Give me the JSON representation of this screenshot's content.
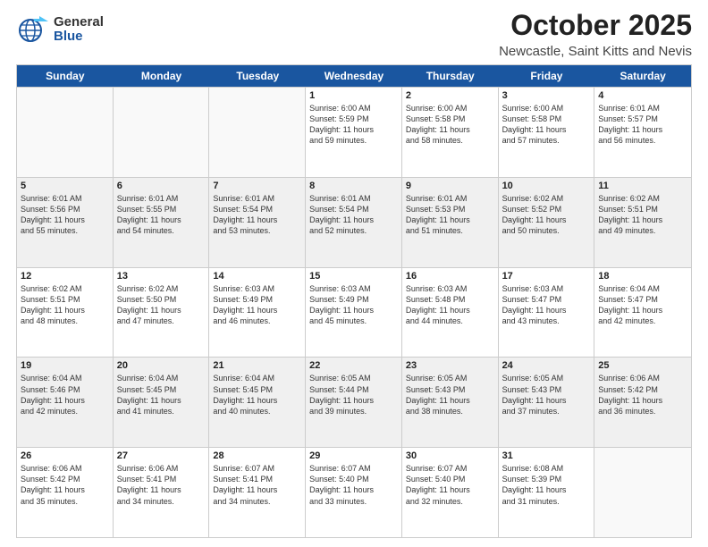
{
  "header": {
    "logo_general": "General",
    "logo_blue": "Blue",
    "month": "October 2025",
    "location": "Newcastle, Saint Kitts and Nevis"
  },
  "weekdays": [
    "Sunday",
    "Monday",
    "Tuesday",
    "Wednesday",
    "Thursday",
    "Friday",
    "Saturday"
  ],
  "weeks": [
    [
      {
        "day": "",
        "info": "",
        "empty": true
      },
      {
        "day": "",
        "info": "",
        "empty": true
      },
      {
        "day": "",
        "info": "",
        "empty": true
      },
      {
        "day": "1",
        "info": "Sunrise: 6:00 AM\nSunset: 5:59 PM\nDaylight: 11 hours\nand 59 minutes."
      },
      {
        "day": "2",
        "info": "Sunrise: 6:00 AM\nSunset: 5:58 PM\nDaylight: 11 hours\nand 58 minutes."
      },
      {
        "day": "3",
        "info": "Sunrise: 6:00 AM\nSunset: 5:58 PM\nDaylight: 11 hours\nand 57 minutes."
      },
      {
        "day": "4",
        "info": "Sunrise: 6:01 AM\nSunset: 5:57 PM\nDaylight: 11 hours\nand 56 minutes."
      }
    ],
    [
      {
        "day": "5",
        "info": "Sunrise: 6:01 AM\nSunset: 5:56 PM\nDaylight: 11 hours\nand 55 minutes.",
        "shaded": true
      },
      {
        "day": "6",
        "info": "Sunrise: 6:01 AM\nSunset: 5:55 PM\nDaylight: 11 hours\nand 54 minutes.",
        "shaded": true
      },
      {
        "day": "7",
        "info": "Sunrise: 6:01 AM\nSunset: 5:54 PM\nDaylight: 11 hours\nand 53 minutes.",
        "shaded": true
      },
      {
        "day": "8",
        "info": "Sunrise: 6:01 AM\nSunset: 5:54 PM\nDaylight: 11 hours\nand 52 minutes.",
        "shaded": true
      },
      {
        "day": "9",
        "info": "Sunrise: 6:01 AM\nSunset: 5:53 PM\nDaylight: 11 hours\nand 51 minutes.",
        "shaded": true
      },
      {
        "day": "10",
        "info": "Sunrise: 6:02 AM\nSunset: 5:52 PM\nDaylight: 11 hours\nand 50 minutes.",
        "shaded": true
      },
      {
        "day": "11",
        "info": "Sunrise: 6:02 AM\nSunset: 5:51 PM\nDaylight: 11 hours\nand 49 minutes.",
        "shaded": true
      }
    ],
    [
      {
        "day": "12",
        "info": "Sunrise: 6:02 AM\nSunset: 5:51 PM\nDaylight: 11 hours\nand 48 minutes."
      },
      {
        "day": "13",
        "info": "Sunrise: 6:02 AM\nSunset: 5:50 PM\nDaylight: 11 hours\nand 47 minutes."
      },
      {
        "day": "14",
        "info": "Sunrise: 6:03 AM\nSunset: 5:49 PM\nDaylight: 11 hours\nand 46 minutes."
      },
      {
        "day": "15",
        "info": "Sunrise: 6:03 AM\nSunset: 5:49 PM\nDaylight: 11 hours\nand 45 minutes."
      },
      {
        "day": "16",
        "info": "Sunrise: 6:03 AM\nSunset: 5:48 PM\nDaylight: 11 hours\nand 44 minutes."
      },
      {
        "day": "17",
        "info": "Sunrise: 6:03 AM\nSunset: 5:47 PM\nDaylight: 11 hours\nand 43 minutes."
      },
      {
        "day": "18",
        "info": "Sunrise: 6:04 AM\nSunset: 5:47 PM\nDaylight: 11 hours\nand 42 minutes."
      }
    ],
    [
      {
        "day": "19",
        "info": "Sunrise: 6:04 AM\nSunset: 5:46 PM\nDaylight: 11 hours\nand 42 minutes.",
        "shaded": true
      },
      {
        "day": "20",
        "info": "Sunrise: 6:04 AM\nSunset: 5:45 PM\nDaylight: 11 hours\nand 41 minutes.",
        "shaded": true
      },
      {
        "day": "21",
        "info": "Sunrise: 6:04 AM\nSunset: 5:45 PM\nDaylight: 11 hours\nand 40 minutes.",
        "shaded": true
      },
      {
        "day": "22",
        "info": "Sunrise: 6:05 AM\nSunset: 5:44 PM\nDaylight: 11 hours\nand 39 minutes.",
        "shaded": true
      },
      {
        "day": "23",
        "info": "Sunrise: 6:05 AM\nSunset: 5:43 PM\nDaylight: 11 hours\nand 38 minutes.",
        "shaded": true
      },
      {
        "day": "24",
        "info": "Sunrise: 6:05 AM\nSunset: 5:43 PM\nDaylight: 11 hours\nand 37 minutes.",
        "shaded": true
      },
      {
        "day": "25",
        "info": "Sunrise: 6:06 AM\nSunset: 5:42 PM\nDaylight: 11 hours\nand 36 minutes.",
        "shaded": true
      }
    ],
    [
      {
        "day": "26",
        "info": "Sunrise: 6:06 AM\nSunset: 5:42 PM\nDaylight: 11 hours\nand 35 minutes."
      },
      {
        "day": "27",
        "info": "Sunrise: 6:06 AM\nSunset: 5:41 PM\nDaylight: 11 hours\nand 34 minutes."
      },
      {
        "day": "28",
        "info": "Sunrise: 6:07 AM\nSunset: 5:41 PM\nDaylight: 11 hours\nand 34 minutes."
      },
      {
        "day": "29",
        "info": "Sunrise: 6:07 AM\nSunset: 5:40 PM\nDaylight: 11 hours\nand 33 minutes."
      },
      {
        "day": "30",
        "info": "Sunrise: 6:07 AM\nSunset: 5:40 PM\nDaylight: 11 hours\nand 32 minutes."
      },
      {
        "day": "31",
        "info": "Sunrise: 6:08 AM\nSunset: 5:39 PM\nDaylight: 11 hours\nand 31 minutes."
      },
      {
        "day": "",
        "info": "",
        "empty": true
      }
    ]
  ]
}
